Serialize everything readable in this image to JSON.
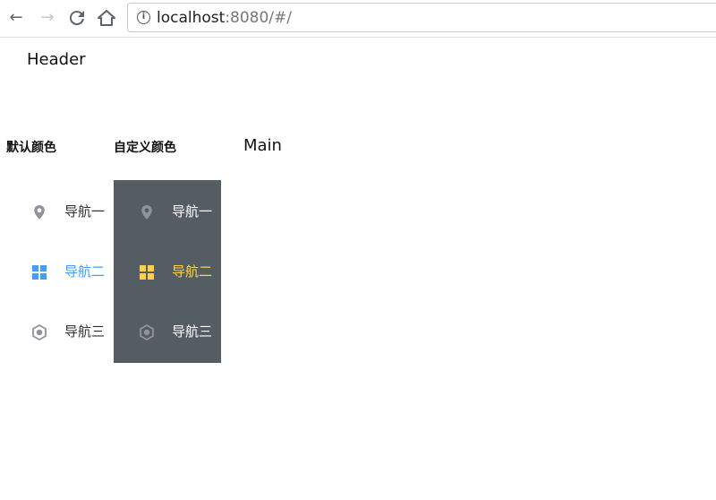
{
  "browser": {
    "url_host": "localhost",
    "url_rest": ":8080/#/"
  },
  "header": {
    "text": "Header"
  },
  "main": {
    "text": "Main"
  },
  "menus": {
    "default": {
      "title": "默认颜色",
      "text_color": "#303133",
      "active_color": "#409eff",
      "items": [
        {
          "label": "导航一",
          "icon": "location-icon"
        },
        {
          "label": "导航二",
          "icon": "menu-grid-icon"
        },
        {
          "label": "导航三",
          "icon": "setting-icon"
        }
      ]
    },
    "custom": {
      "title": "自定义颜色",
      "background": "#545c64",
      "text_color": "#ffffff",
      "active_color": "#ffd04b",
      "items": [
        {
          "label": "导航一",
          "icon": "location-icon"
        },
        {
          "label": "导航二",
          "icon": "menu-grid-icon"
        },
        {
          "label": "导航三",
          "icon": "setting-icon"
        }
      ]
    }
  }
}
